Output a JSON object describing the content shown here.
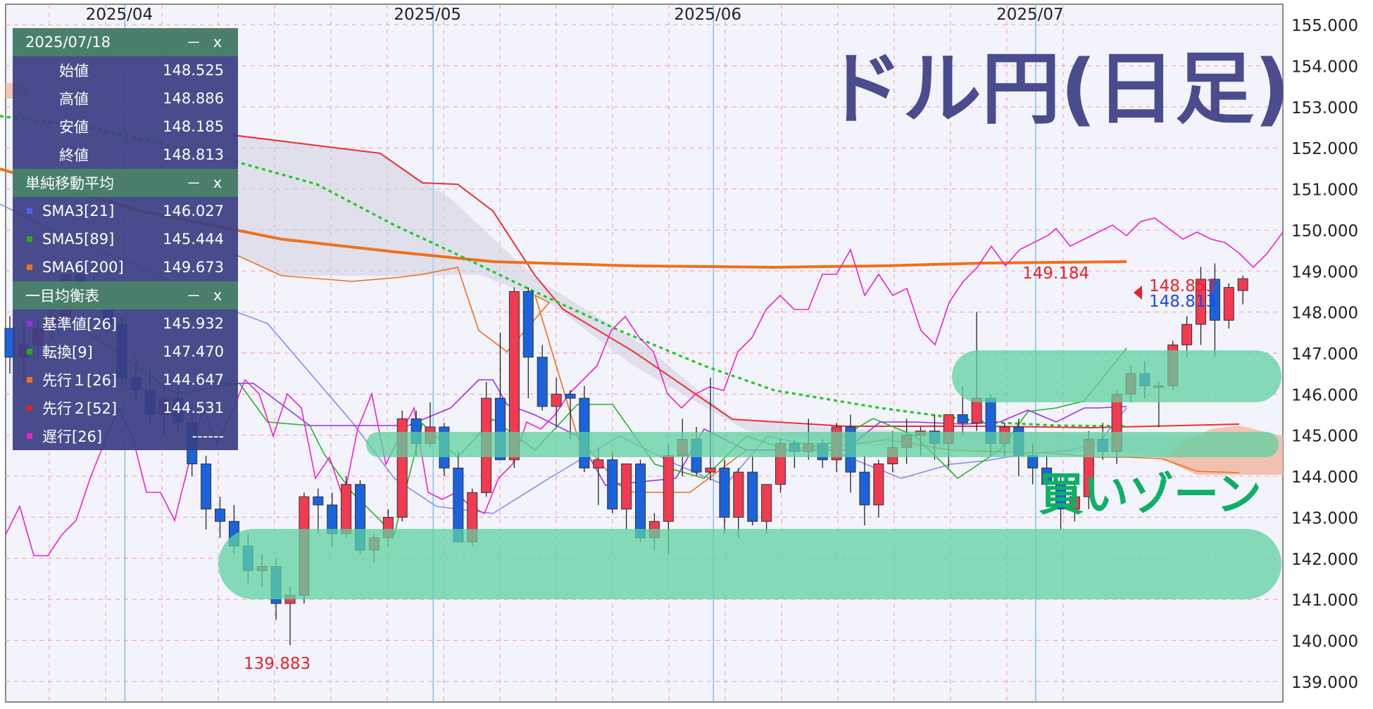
{
  "chart_data": {
    "type": "candlestick",
    "title": "ドル円(日足)",
    "x_months": [
      "2025/04",
      "2025/05",
      "2025/06",
      "2025/07"
    ],
    "ylim": [
      138.5,
      155.5
    ],
    "y_ticks": [
      "155.000",
      "154.000",
      "153.000",
      "152.000",
      "151.000",
      "150.000",
      "149.000",
      "148.000",
      "147.000",
      "146.000",
      "145.000",
      "144.000",
      "143.000",
      "142.000",
      "141.000",
      "140.000",
      "139.000"
    ],
    "candles": [
      [
        147.6,
        147.9,
        146.5,
        146.9
      ],
      [
        146.9,
        147.7,
        146.3,
        147.2
      ],
      [
        147.2,
        147.8,
        146.9,
        147.6
      ],
      [
        147.6,
        148.1,
        147.3,
        147.9
      ],
      [
        147.9,
        149.1,
        147.7,
        148.9
      ],
      [
        148.9,
        149.3,
        148.5,
        148.7
      ],
      [
        148.7,
        149.1,
        148.3,
        148.6
      ],
      [
        148.6,
        148.8,
        147.5,
        147.7
      ],
      [
        147.7,
        147.9,
        146.2,
        146.4
      ],
      [
        146.4,
        146.9,
        145.8,
        146.1
      ],
      [
        146.1,
        146.6,
        145.3,
        145.5
      ],
      [
        145.5,
        146.2,
        145.0,
        145.9
      ],
      [
        145.9,
        146.3,
        145.1,
        145.3
      ],
      [
        145.3,
        145.7,
        144.0,
        144.3
      ],
      [
        144.3,
        144.5,
        142.7,
        143.2
      ],
      [
        143.2,
        143.5,
        142.5,
        142.9
      ],
      [
        142.9,
        143.3,
        142.1,
        142.3
      ],
      [
        142.3,
        142.6,
        141.4,
        141.7
      ],
      [
        141.7,
        142.1,
        141.3,
        141.8
      ],
      [
        141.8,
        142.0,
        140.5,
        140.9
      ],
      [
        140.9,
        141.3,
        139.883,
        141.1
      ],
      [
        141.1,
        143.6,
        140.9,
        143.5
      ],
      [
        143.5,
        143.7,
        142.6,
        143.3
      ],
      [
        143.3,
        143.6,
        142.3,
        142.6
      ],
      [
        142.6,
        144.0,
        142.5,
        143.8
      ],
      [
        143.8,
        143.9,
        142.1,
        142.2
      ],
      [
        142.2,
        142.6,
        141.9,
        142.5
      ],
      [
        142.5,
        143.2,
        142.3,
        143.0
      ],
      [
        143.0,
        145.6,
        142.9,
        145.4
      ],
      [
        145.4,
        145.6,
        144.5,
        144.8
      ],
      [
        144.8,
        145.8,
        144.7,
        145.2
      ],
      [
        145.2,
        145.3,
        144.0,
        144.2
      ],
      [
        144.2,
        144.6,
        142.7,
        142.4
      ],
      [
        142.4,
        143.7,
        142.3,
        143.6
      ],
      [
        143.6,
        146.3,
        143.5,
        145.9
      ],
      [
        145.9,
        147.5,
        144.8,
        144.4
      ],
      [
        144.4,
        148.6,
        144.2,
        148.5
      ],
      [
        148.5,
        148.6,
        145.9,
        146.9
      ],
      [
        146.9,
        147.2,
        145.6,
        145.7
      ],
      [
        145.7,
        146.4,
        145.2,
        146.0
      ],
      [
        146.0,
        146.1,
        144.9,
        145.9
      ],
      [
        145.9,
        146.2,
        144.1,
        144.2
      ],
      [
        144.2,
        144.7,
        143.3,
        144.4
      ],
      [
        144.4,
        144.6,
        143.1,
        143.2
      ],
      [
        143.2,
        143.9,
        142.7,
        144.3
      ],
      [
        144.3,
        144.4,
        142.4,
        142.5
      ],
      [
        142.5,
        143.1,
        142.2,
        142.9
      ],
      [
        142.9,
        144.8,
        142.1,
        144.5
      ],
      [
        144.5,
        145.4,
        144.0,
        144.9
      ],
      [
        144.9,
        145.2,
        144.0,
        144.1
      ],
      [
        144.1,
        146.4,
        143.9,
        144.2
      ],
      [
        144.2,
        144.4,
        142.6,
        143.0
      ],
      [
        143.0,
        144.2,
        142.5,
        144.1
      ],
      [
        144.1,
        144.5,
        142.8,
        142.9
      ],
      [
        142.9,
        143.4,
        142.6,
        143.8
      ],
      [
        143.8,
        144.9,
        143.6,
        144.8
      ],
      [
        144.8,
        144.9,
        144.2,
        144.6
      ],
      [
        144.6,
        145.4,
        144.4,
        144.8
      ],
      [
        144.8,
        144.9,
        144.2,
        144.4
      ],
      [
        144.4,
        145.3,
        144.1,
        145.2
      ],
      [
        145.2,
        145.5,
        143.6,
        144.1
      ],
      [
        144.1,
        144.5,
        142.8,
        143.3
      ],
      [
        143.3,
        144.4,
        143.0,
        144.3
      ],
      [
        144.3,
        145.1,
        144.1,
        144.7
      ],
      [
        144.7,
        145.4,
        144.3,
        145.0
      ],
      [
        145.0,
        145.2,
        144.5,
        145.1
      ],
      [
        145.1,
        145.5,
        144.4,
        144.8
      ],
      [
        144.8,
        145.1,
        144.2,
        145.5
      ],
      [
        145.5,
        146.2,
        145.0,
        145.3
      ],
      [
        145.3,
        148.0,
        145.1,
        145.9
      ],
      [
        145.9,
        146.0,
        144.5,
        144.8
      ],
      [
        144.8,
        145.3,
        144.5,
        145.2
      ],
      [
        145.2,
        145.4,
        144.0,
        144.5
      ],
      [
        144.5,
        144.8,
        143.8,
        144.2
      ],
      [
        144.2,
        144.5,
        143.3,
        143.8
      ],
      [
        143.8,
        144.0,
        142.7,
        143.2
      ],
      [
        143.2,
        143.9,
        142.9,
        143.5
      ],
      [
        143.5,
        145.1,
        143.2,
        144.9
      ],
      [
        144.9,
        145.3,
        144.4,
        144.6
      ],
      [
        144.6,
        146.1,
        144.3,
        146.0
      ],
      [
        146.0,
        146.7,
        145.8,
        146.5
      ],
      [
        146.5,
        146.8,
        145.9,
        146.2
      ],
      [
        146.2,
        146.3,
        145.2,
        146.2
      ],
      [
        146.2,
        147.3,
        146.1,
        147.2
      ],
      [
        147.2,
        147.9,
        146.9,
        147.7
      ],
      [
        147.7,
        149.1,
        147.2,
        148.8
      ],
      [
        148.8,
        149.184,
        146.9,
        147.8
      ],
      [
        147.8,
        148.7,
        147.6,
        148.6
      ],
      [
        148.525,
        148.886,
        148.185,
        148.813
      ]
    ],
    "annotations": {
      "high_label": "149.184",
      "low_label": "139.883",
      "bid": "148.853",
      "ask": "148.813",
      "zone_label": "買いゾーン"
    }
  },
  "panel": {
    "ohlc": {
      "date": "2025/07/18",
      "rows": [
        {
          "label": "始値",
          "value": "148.525"
        },
        {
          "label": "高値",
          "value": "148.886"
        },
        {
          "label": "安値",
          "value": "148.185"
        },
        {
          "label": "終値",
          "value": "148.813"
        }
      ]
    },
    "sma": {
      "title": "単純移動平均",
      "rows": [
        {
          "label": "SMA3[21]",
          "value": "146.027",
          "color": "#4f5ff0"
        },
        {
          "label": "SMA5[89]",
          "value": "145.444",
          "color": "#1db31d"
        },
        {
          "label": "SMA6[200]",
          "value": "149.673",
          "color": "#f0701a"
        }
      ]
    },
    "ichimoku": {
      "title": "一目均衡表",
      "rows": [
        {
          "label": "基準値[26]",
          "value": "145.932",
          "color": "#9b2fe8"
        },
        {
          "label": "転換[9]",
          "value": "147.470",
          "color": "#1db31d"
        },
        {
          "label": "先行１[26]",
          "value": "144.647",
          "color": "#f0701a"
        },
        {
          "label": "先行２[52]",
          "value": "144.531",
          "color": "#e8222a"
        },
        {
          "label": "遅行[26]",
          "value": "------",
          "color": "#ee22c8"
        }
      ]
    },
    "minimize": "－",
    "close": "x"
  },
  "colors": {
    "up": "#f23a50",
    "down": "#1a63dd",
    "title": "#4a4c8e",
    "zone": "#5fd2a0",
    "zone_text": "#0db064"
  }
}
